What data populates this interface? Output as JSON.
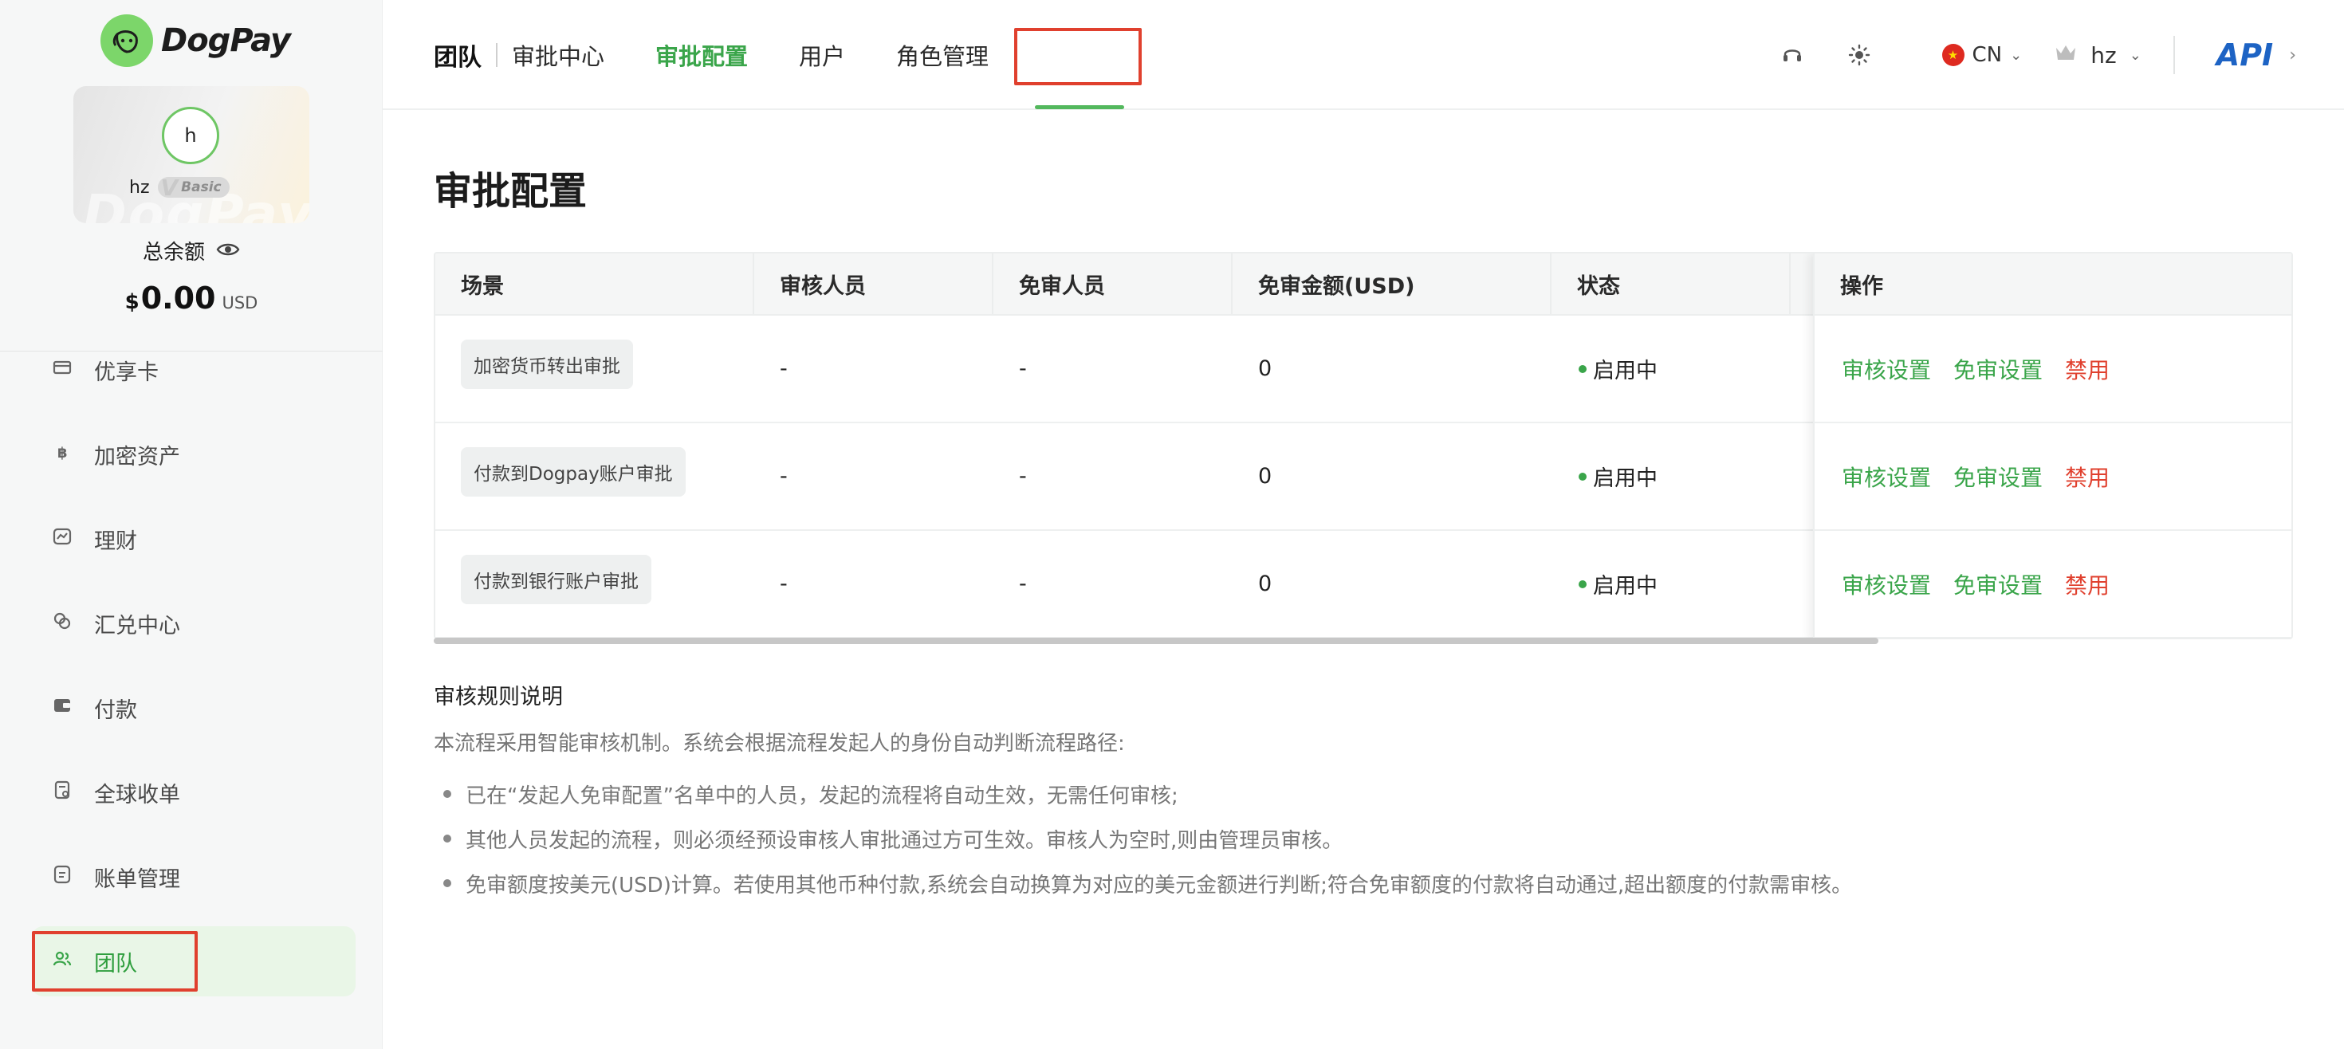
{
  "brand": {
    "name": "DogPay",
    "accent": "#3aa54a",
    "highlight": "#e0402e"
  },
  "profile": {
    "avatar_letter": "h",
    "username": "hz",
    "vip_level": "Basic",
    "balance_label": "总余额",
    "balance_symbol": "$",
    "balance_amount": "0.00",
    "balance_currency": "USD"
  },
  "sidebar": {
    "items": [
      {
        "label": "优享卡",
        "icon": "card-icon"
      },
      {
        "label": "加密资产",
        "icon": "bitcoin-icon"
      },
      {
        "label": "理财",
        "icon": "chart-icon"
      },
      {
        "label": "汇兑中心",
        "icon": "exchange-icon"
      },
      {
        "label": "付款",
        "icon": "wallet-icon"
      },
      {
        "label": "全球收单",
        "icon": "receipt-icon"
      },
      {
        "label": "账单管理",
        "icon": "bill-icon"
      },
      {
        "label": "团队",
        "icon": "team-icon",
        "active": true
      }
    ]
  },
  "header": {
    "section": "团队",
    "tabs": [
      "审批中心",
      "审批配置",
      "用户",
      "角色管理"
    ],
    "active_tab": "审批配置",
    "language": "CN",
    "user": "hz",
    "api_label": "API"
  },
  "main": {
    "title": "审批配置",
    "table": {
      "columns": [
        "场景",
        "审核人员",
        "免审人员",
        "免审金额(USD)",
        "状态",
        "操作"
      ],
      "rows": [
        {
          "scene": "加密货币转出审批",
          "reviewers": "-",
          "exempt": "-",
          "exempt_amount": "0",
          "status": "启用中"
        },
        {
          "scene": "付款到Dogpay账户审批",
          "reviewers": "-",
          "exempt": "-",
          "exempt_amount": "0",
          "status": "启用中"
        },
        {
          "scene": "付款到银行账户审批",
          "reviewers": "-",
          "exempt": "-",
          "exempt_amount": "0",
          "status": "启用中"
        }
      ],
      "actions": {
        "review_settings": "审核设置",
        "exempt_settings": "免审设置",
        "disable": "禁用"
      }
    },
    "rules": {
      "title": "审核规则说明",
      "intro": "本流程采用智能审核机制。系统会根据流程发起人的身份自动判断流程路径:",
      "items": [
        "已在“发起人免审配置”名单中的人员，发起的流程将自动生效，无需任何审核;",
        "其他人员发起的流程，则必须经预设审核人审批通过方可生效。审核人为空时,则由管理员审核。",
        "免审额度按美元(USD)计算。若使用其他币种付款,系统会自动换算为对应的美元金额进行判断;符合免审额度的付款将自动通过,超出额度的付款需审核。"
      ]
    }
  }
}
